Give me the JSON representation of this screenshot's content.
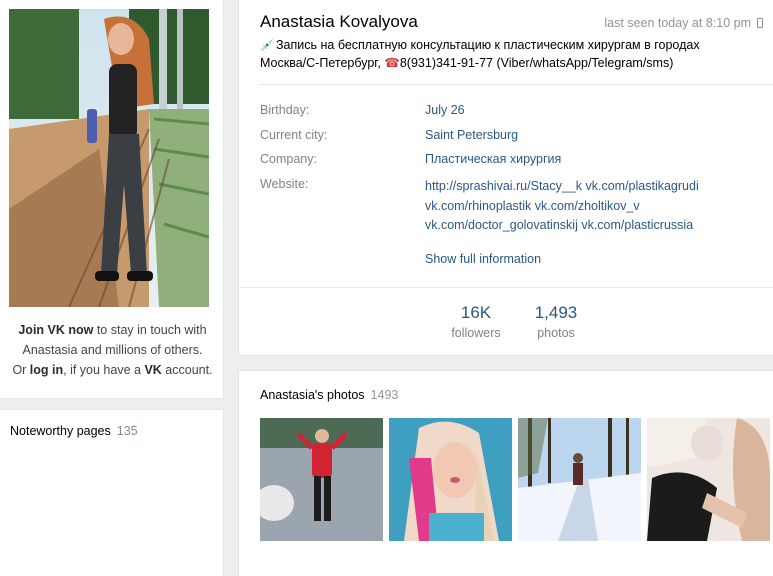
{
  "profile": {
    "name": "Anastasia Kovalyova",
    "last_seen": "last seen today at 8:10 pm",
    "status_line1": "Запись на бесплатную консультацию к пластическим хирургам в городах",
    "status_line2_a": "Москва/С-Петербург, ",
    "status_phone": "8(931)341-91-77 (Viber/whatsApp/Telegram/sms)",
    "info": {
      "birthday_label": "Birthday:",
      "birthday": "July 26",
      "city_label": "Current city:",
      "city": "Saint Petersburg",
      "company_label": "Company:",
      "company": "Пластическая хирургия",
      "website_label": "Website:",
      "website_lines": [
        "http://sprashivai.ru/Stacy__k vk.com/plastikagrudi",
        "vk.com/rhinoplastik vk.com/zholtikov_v",
        "vk.com/doctor_golovatinskij vk.com/plasticrussia"
      ]
    },
    "show_full": "Show full information",
    "stats": {
      "followers_count": "16K",
      "followers_label": "followers",
      "photos_count": "1,493",
      "photos_label": "photos"
    }
  },
  "join": {
    "join_link": "Join VK now",
    "line1_rest": " to stay in touch with",
    "line2": "Anastasia and millions of others.",
    "line3_a": "Or ",
    "login_link": "log in",
    "line3_b": ", if you have a ",
    "vk": "VK",
    "line3_c": " account."
  },
  "noteworthy": {
    "title": "Noteworthy pages",
    "count": "135"
  },
  "photos": {
    "title": "Anastasia's photos",
    "count": "1493"
  },
  "colors": {
    "link": "#2a5885",
    "label": "#828282",
    "background": "#edeef0"
  }
}
